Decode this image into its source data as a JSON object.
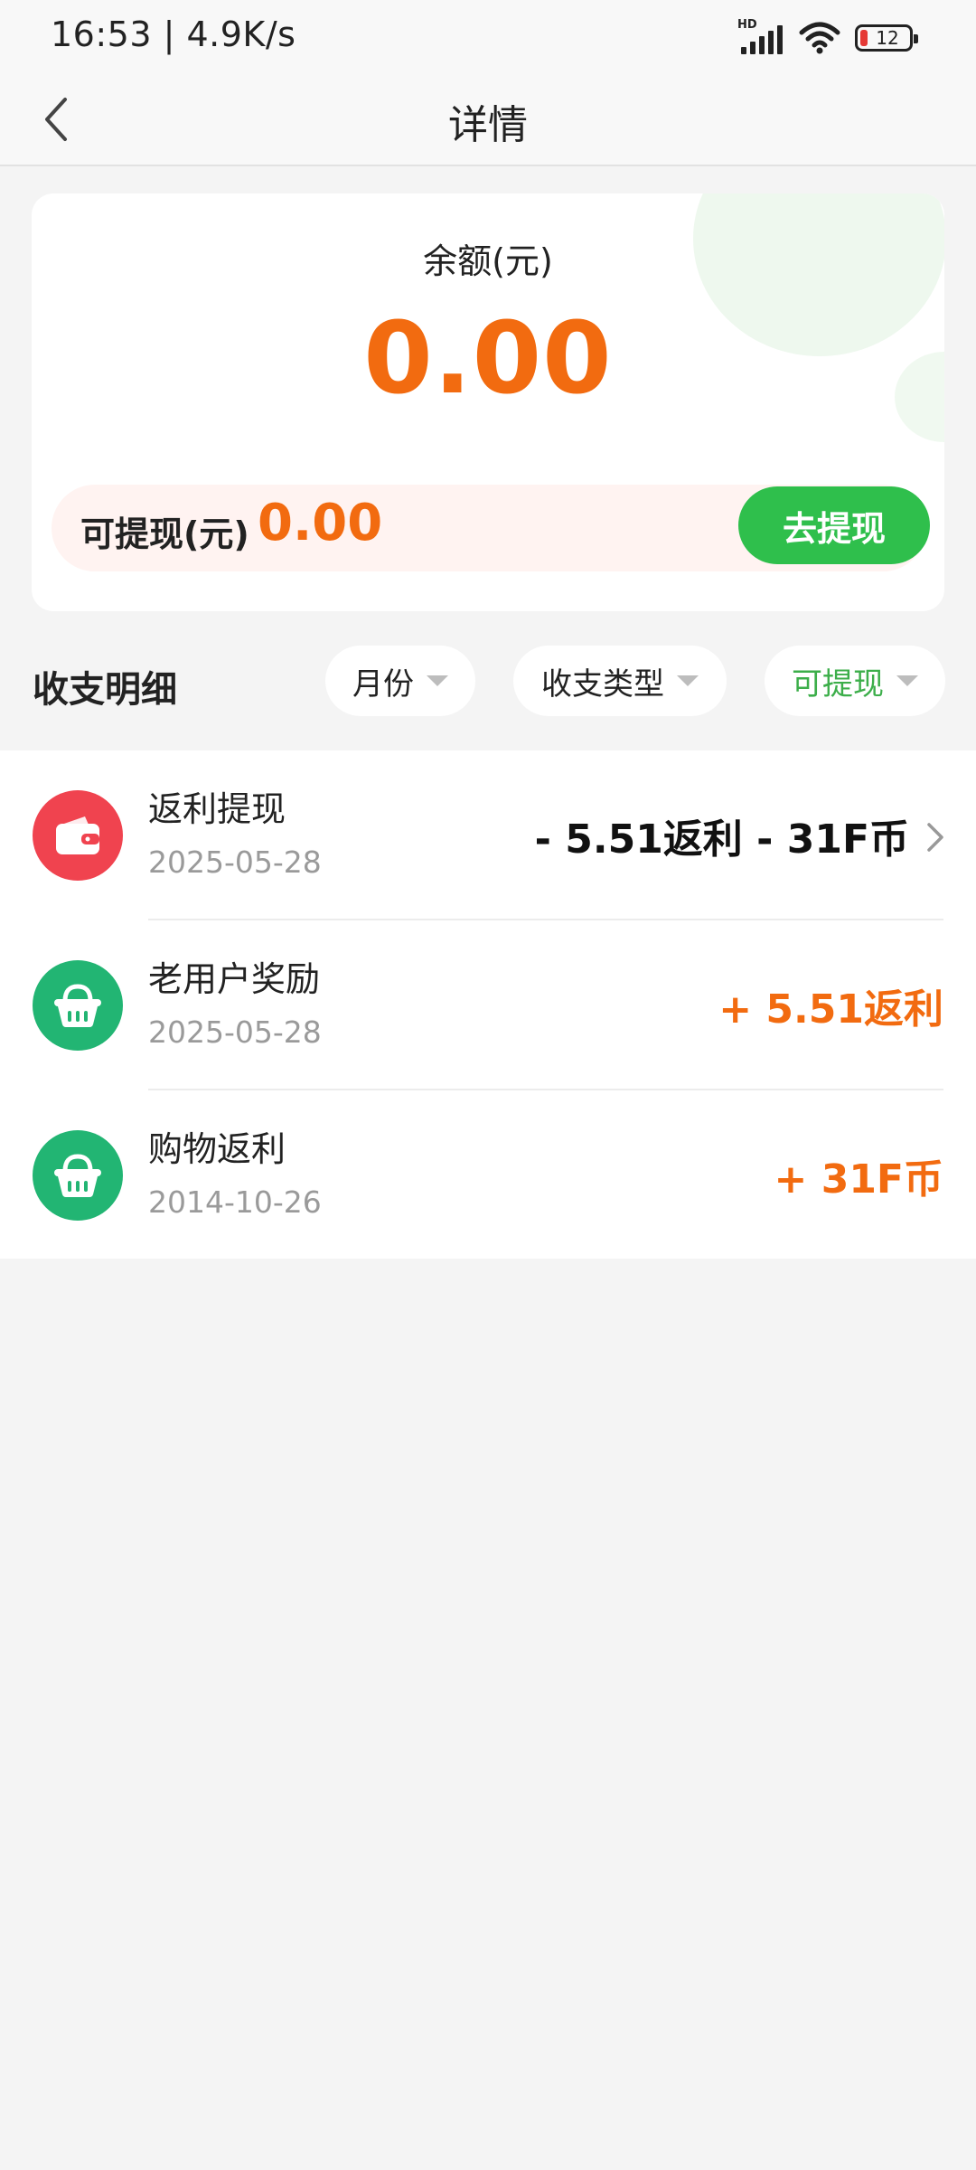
{
  "status_bar": {
    "time": "16:53 | 4.9K/s",
    "signal_label": "HD",
    "battery_level": "12",
    "battery_color": "#e53935"
  },
  "nav": {
    "title": "详情",
    "back_icon": "chevron-left-icon"
  },
  "balance": {
    "label": "余额(元)",
    "value": "0.00",
    "withdrawable_label": "可提现(元)",
    "withdrawable_value": "0.00",
    "withdraw_button": "去提现"
  },
  "filters": {
    "section_title": "收支明细",
    "month": "月份",
    "type": "收支类型",
    "withdrawable": "可提现"
  },
  "transactions": [
    {
      "title": "返利提现",
      "date": "2025-05-28",
      "amount": "- 5.51返利 - 31F币",
      "icon": "wallet-icon",
      "icon_color": "#f0434f",
      "has_chevron": true
    },
    {
      "title": "老用户奖励",
      "date": "2025-05-28",
      "amount": "+ 5.51返利",
      "icon": "basket-icon",
      "icon_color": "#22b573",
      "has_chevron": false
    },
    {
      "title": "购物返利",
      "date": "2014-10-26",
      "amount": "+ 31F币",
      "icon": "basket-icon",
      "icon_color": "#22b573",
      "has_chevron": false
    }
  ],
  "colors": {
    "accent_orange": "#f26b10",
    "accent_green": "#2fbf4c",
    "filter_active": "#3cae4a"
  }
}
